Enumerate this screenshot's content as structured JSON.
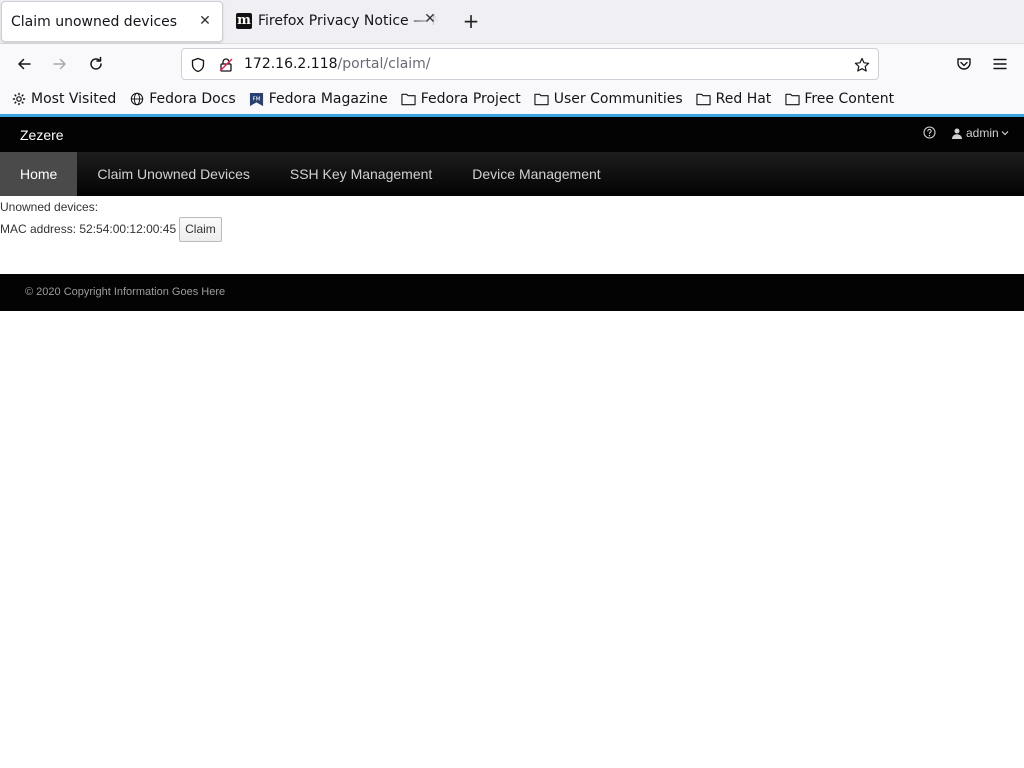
{
  "browser": {
    "tabs": [
      {
        "title": "Claim unowned devices",
        "active": true
      },
      {
        "title": "Firefox Privacy Notice — Mozilla",
        "active": false,
        "favicon": "m"
      }
    ],
    "url": {
      "host": "172.16.2.118",
      "path": "/portal/claim/"
    },
    "bookmarks": [
      {
        "label": "Most Visited",
        "icon": "gear-icon"
      },
      {
        "label": "Fedora Docs",
        "icon": "globe-icon"
      },
      {
        "label": "Fedora Magazine",
        "icon": "fm-icon"
      },
      {
        "label": "Fedora Project",
        "icon": "folder-icon"
      },
      {
        "label": "User Communities",
        "icon": "folder-icon"
      },
      {
        "label": "Red Hat",
        "icon": "folder-icon"
      },
      {
        "label": "Free Content",
        "icon": "folder-icon"
      }
    ]
  },
  "app": {
    "brand": "Zezere",
    "user": "admin",
    "nav": [
      {
        "label": "Home",
        "active": true
      },
      {
        "label": "Claim Unowned Devices",
        "active": false
      },
      {
        "label": "SSH Key Management",
        "active": false
      },
      {
        "label": "Device Management",
        "active": false
      }
    ],
    "content": {
      "heading": "Unowned devices:",
      "mac_text": "MAC address: 52:54:00:12:00:45",
      "claim_label": "Claim"
    },
    "footer": "© 2020 Copyright Information Goes Here"
  },
  "colors": {
    "accent": "#39a5dc",
    "masthead": "#030303",
    "active_nav": "#4a4a4a"
  }
}
